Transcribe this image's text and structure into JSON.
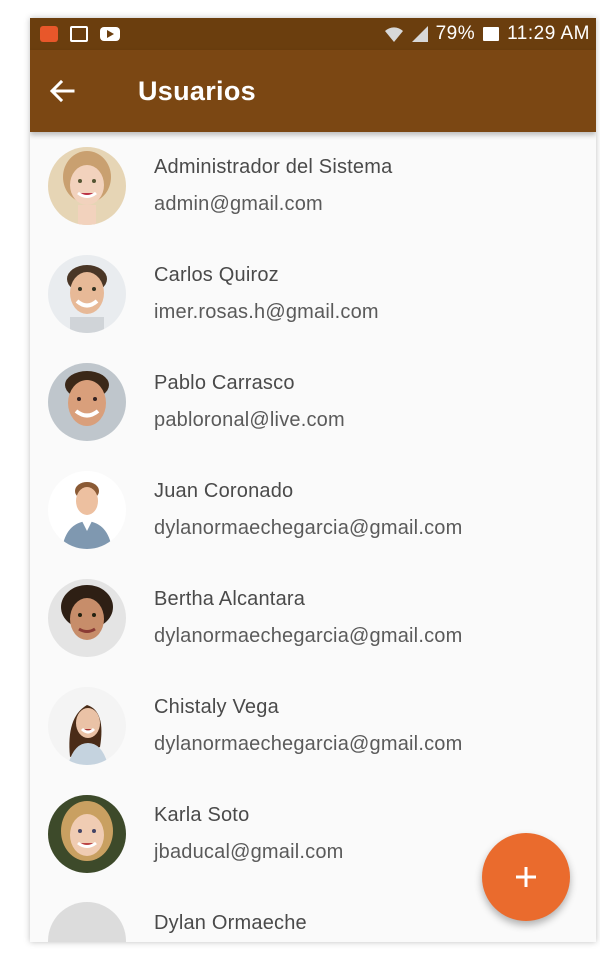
{
  "status_bar": {
    "battery": "79%",
    "time": "11:29 AM",
    "icons": [
      "notification-icon",
      "gallery-icon",
      "youtube-icon",
      "wifi-icon",
      "signal-icon",
      "battery-icon"
    ]
  },
  "app_bar": {
    "title": "Usuarios",
    "back_icon": "arrow-back-icon",
    "color": "#7b4713"
  },
  "users": [
    {
      "name": "Administrador del Sistema",
      "email": "admin@gmail.com"
    },
    {
      "name": "Carlos Quiroz",
      "email": "imer.rosas.h@gmail.com"
    },
    {
      "name": "Pablo Carrasco",
      "email": "pabloronal@live.com"
    },
    {
      "name": "Juan Coronado",
      "email": "dylanormaechegarcia@gmail.com"
    },
    {
      "name": "Bertha Alcantara",
      "email": "dylanormaechegarcia@gmail.com"
    },
    {
      "name": "Chistaly Vega",
      "email": "dylanormaechegarcia@gmail.com"
    },
    {
      "name": "Karla Soto",
      "email": "jbaducal@gmail.com"
    },
    {
      "name": "Dylan Ormaeche",
      "email": ""
    }
  ],
  "fab": {
    "icon": "add-icon",
    "color": "#ea6b2d"
  }
}
